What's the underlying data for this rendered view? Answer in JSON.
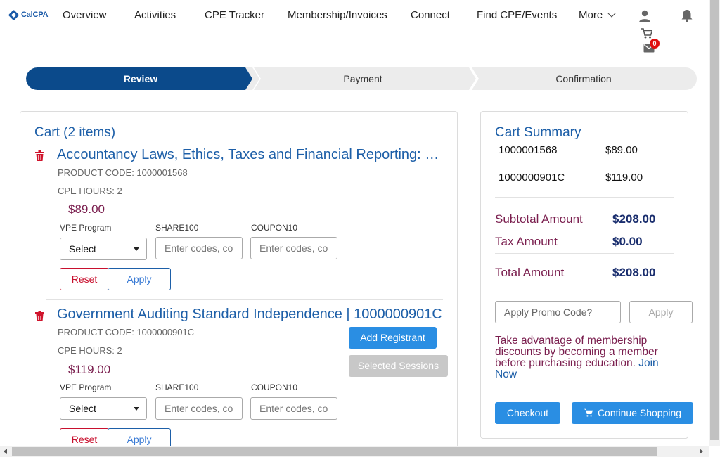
{
  "nav": {
    "logo": "CalCPA",
    "items": [
      "Overview",
      "Activities",
      "CPE Tracker",
      "Membership/Invoices",
      "Connect",
      "Find CPE/Events",
      "More"
    ],
    "cart_count": "0"
  },
  "steps": [
    "Review",
    "Payment",
    "Confirmation"
  ],
  "active_step": "Review",
  "cart": {
    "title": "Cart (2 items)",
    "items": [
      {
        "title": "Accountancy Laws, Ethics, Taxes and Financial Reporting: R...",
        "product_code": "PRODUCT CODE: 1000001568",
        "cpe_hours": "CPE HOURS: 2",
        "price": "$89.00",
        "fields": {
          "vpe_label": "VPE Program",
          "vpe_value": "Select",
          "share_label": "SHARE100",
          "share_placeholder": "Enter codes, co",
          "coupon_label": "COUPON10",
          "coupon_placeholder": "Enter codes, co"
        },
        "reset": "Reset",
        "apply": "Apply"
      },
      {
        "title": "Government Auditing Standard Independence | 1000000901C",
        "product_code": "PRODUCT CODE: 1000000901C",
        "cpe_hours": "CPE HOURS: 2",
        "price": "$119.00",
        "add_registrant": "Add Registrant",
        "selected_sessions": "Selected Sessions",
        "fields": {
          "vpe_label": "VPE Program",
          "vpe_value": "Select",
          "share_label": "SHARE100",
          "share_placeholder": "Enter codes, co",
          "coupon_label": "COUPON10",
          "coupon_placeholder": "Enter codes, co"
        },
        "reset": "Reset",
        "apply": "Apply"
      }
    ]
  },
  "summary": {
    "title": "Cart Summary",
    "lines": [
      {
        "code": "1000001568",
        "amount": "$89.00"
      },
      {
        "code": "1000000901C",
        "amount": "$119.00"
      }
    ],
    "subtotal_label": "Subtotal Amount",
    "subtotal": "$208.00",
    "tax_label": "Tax Amount",
    "tax": "$0.00",
    "total_label": "Total Amount",
    "total": "$208.00",
    "promo_placeholder": "Apply Promo Code?",
    "promo_apply": "Apply",
    "member_msg": "Take advantage of membership discounts by becoming a member before purchasing education.",
    "join": "Join Now",
    "checkout": "Checkout",
    "continue": "Continue Shopping"
  },
  "colors": {
    "primary_blue": "#1d5fa8",
    "step_active": "#0b4a8b",
    "price": "#7a1e4e",
    "button_blue": "#2a8ee3",
    "reset_red": "#c8102e"
  }
}
